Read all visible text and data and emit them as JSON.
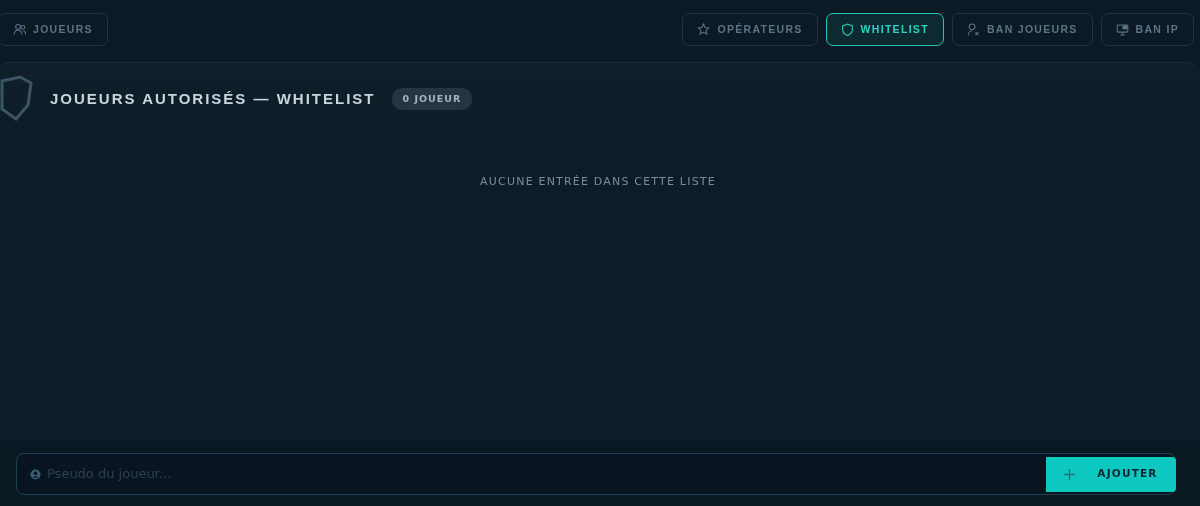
{
  "tabs_left": [
    {
      "label": "JOUEURS",
      "selected": false
    }
  ],
  "tabs_right": [
    {
      "label": "OPÉRATEURS",
      "selected": false
    },
    {
      "label": "WHITELIST",
      "selected": true
    },
    {
      "label": "BAN JOUEURS",
      "selected": false
    },
    {
      "label": "BAN IP",
      "selected": false
    }
  ],
  "panel": {
    "title": "JOUEURS AUTORISÉS — WHITELIST",
    "count": "0 JOUEUR",
    "empty_message": "AUCUNE ENTRÉE DANS CETTE LISTE"
  },
  "add_form": {
    "placeholder": "Pseudo du joueur...",
    "button": "AJOUTER"
  }
}
